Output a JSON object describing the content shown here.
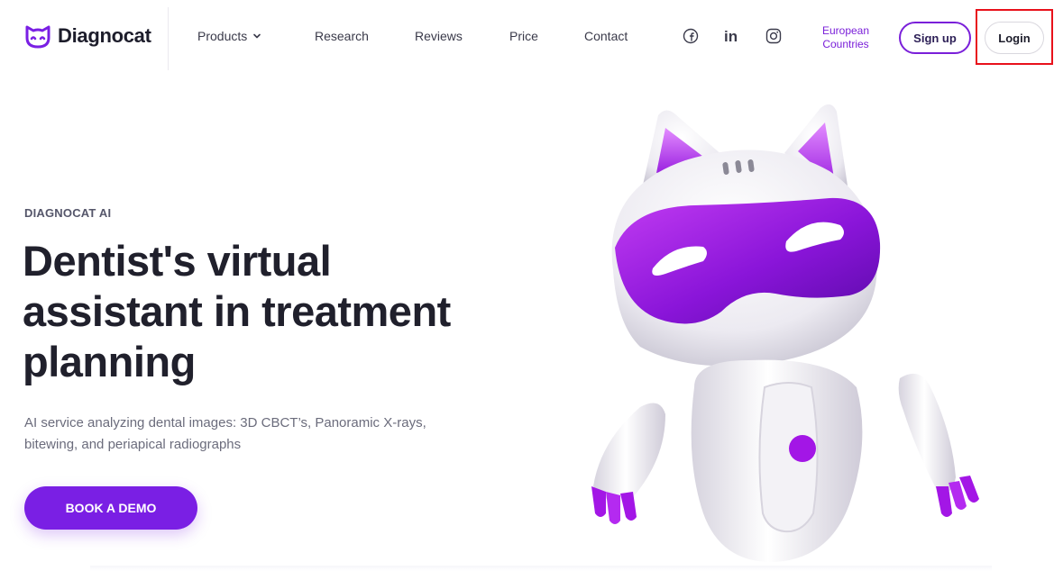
{
  "header": {
    "logo": {
      "text": "Diagnocat",
      "icon": "cat-face-logo-icon"
    },
    "nav": [
      {
        "label": "Products",
        "icon": "chevron-down-icon"
      },
      {
        "label": "Research"
      },
      {
        "label": "Reviews"
      },
      {
        "label": "Price"
      },
      {
        "label": "Contact"
      }
    ],
    "social": [
      {
        "icon": "facebook-icon"
      },
      {
        "label": "in",
        "icon": "linkedin-icon"
      },
      {
        "icon": "instagram-icon"
      }
    ],
    "region": {
      "line1": "European",
      "line2": "Countries"
    },
    "signup_label": "Sign up",
    "login_label": "Login"
  },
  "hero": {
    "eyebrow": "DIAGNOCAT AI",
    "headline": "Dentist's virtual assistant in treatment planning",
    "subtext": "AI service analyzing dental images: 3D CBCT’s, Panoramic X-rays, bitewing, and periapical radiographs",
    "cta_label": "BOOK A DEMO",
    "illustration": "robot-cat-mascot"
  },
  "colors": {
    "accent": "#7a1fe4",
    "region_text": "#7a1fd9",
    "highlight_border": "#e8111b",
    "heading": "#20202c",
    "body_text": "#6b6c7c"
  }
}
